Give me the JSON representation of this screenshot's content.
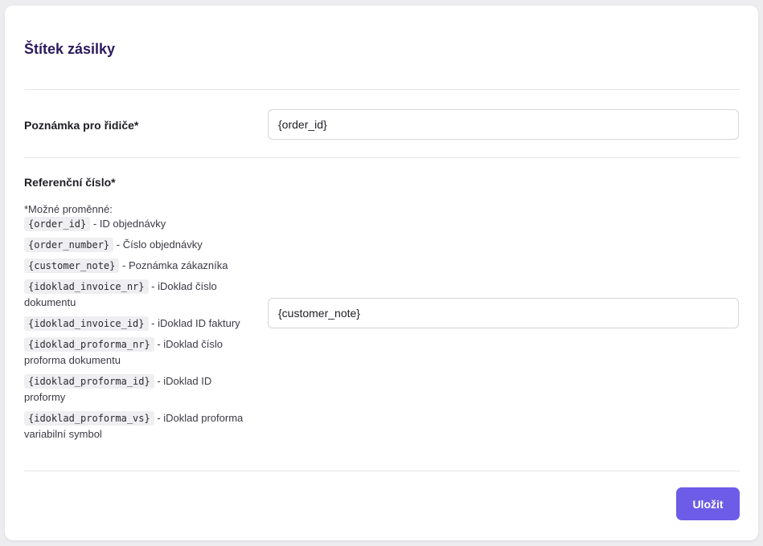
{
  "card": {
    "title": "Štítek zásilky"
  },
  "fields": {
    "driver_note": {
      "label": "Poznámka pro řidiče*",
      "value": "{order_id}"
    },
    "reference": {
      "label": "Referenční číslo*",
      "value": "{customer_note}"
    }
  },
  "help": {
    "intro": "*Možné proměnné:",
    "variables": [
      {
        "code": "{order_id}",
        "desc": "- ID objednávky"
      },
      {
        "code": "{order_number}",
        "desc": "- Číslo objednávky"
      },
      {
        "code": "{customer_note}",
        "desc": "- Poznámka zákazníka"
      },
      {
        "code": "{idoklad_invoice_nr}",
        "desc": "- iDoklad číslo dokumentu"
      },
      {
        "code": "{idoklad_invoice_id}",
        "desc": "- iDoklad ID faktury"
      },
      {
        "code": "{idoklad_proforma_nr}",
        "desc": "- iDoklad číslo proforma dokumentu"
      },
      {
        "code": "{idoklad_proforma_id}",
        "desc": "- iDoklad ID proformy"
      },
      {
        "code": "{idoklad_proforma_vs}",
        "desc": "- iDoklad proforma variabilní symbol"
      }
    ]
  },
  "actions": {
    "save_label": "Uložit"
  },
  "colors": {
    "accent": "#6c5ce7",
    "title": "#2b1a5e"
  }
}
